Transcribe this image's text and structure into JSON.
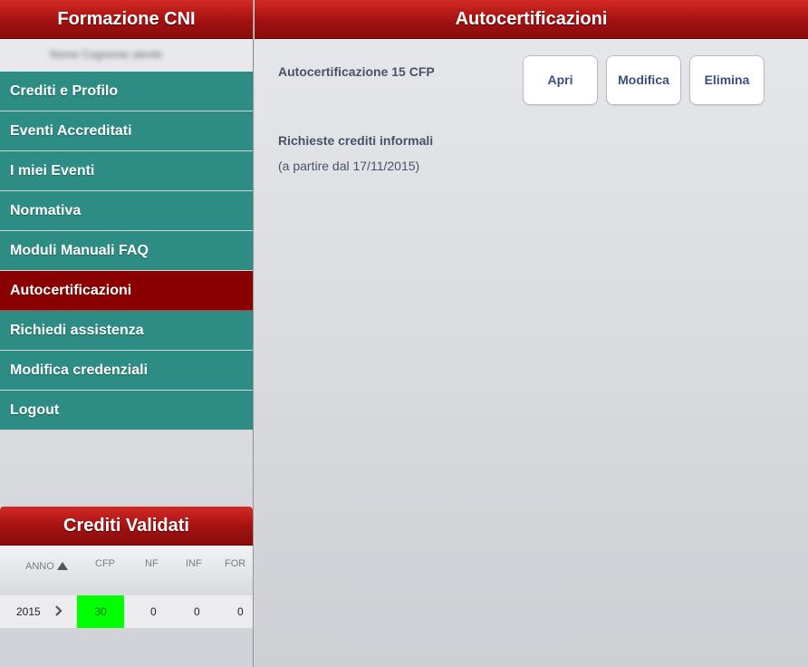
{
  "sidebar": {
    "title": "Formazione CNI",
    "user_name": "Nome Cognome utente",
    "nav": [
      {
        "label": "Crediti e Profilo",
        "active": false
      },
      {
        "label": "Eventi Accreditati",
        "active": false
      },
      {
        "label": "I miei Eventi",
        "active": false
      },
      {
        "label": "Normativa",
        "active": false
      },
      {
        "label": "Moduli Manuali FAQ",
        "active": false
      },
      {
        "label": "Autocertificazioni",
        "active": true
      },
      {
        "label": "Richiedi assistenza",
        "active": false
      },
      {
        "label": "Modifica credenziali",
        "active": false
      },
      {
        "label": "Logout",
        "active": false
      }
    ]
  },
  "credits": {
    "title": "Crediti Validati",
    "columns": {
      "anno": "ANNO",
      "cfp": "CFP",
      "nf": "NF",
      "inf": "INF",
      "for": "FOR"
    },
    "rows": [
      {
        "anno": "2015",
        "cfp": "30",
        "nf": "0",
        "inf": "0",
        "for": "0"
      }
    ]
  },
  "main": {
    "title": "Autocertificazioni",
    "item_label": "Autocertificazione 15 CFP",
    "buttons": {
      "open": "Apri",
      "edit": "Modifica",
      "delete": "Elimina"
    },
    "informal_title": "Richieste crediti informali",
    "informal_note": "(a partire dal 17/11/2015)"
  },
  "colors": {
    "header_red": "#a31111",
    "nav_teal": "#2d8c83",
    "nav_active": "#8a0000",
    "cfp_highlight": "#00ff00",
    "button_text": "#3a4f80"
  }
}
